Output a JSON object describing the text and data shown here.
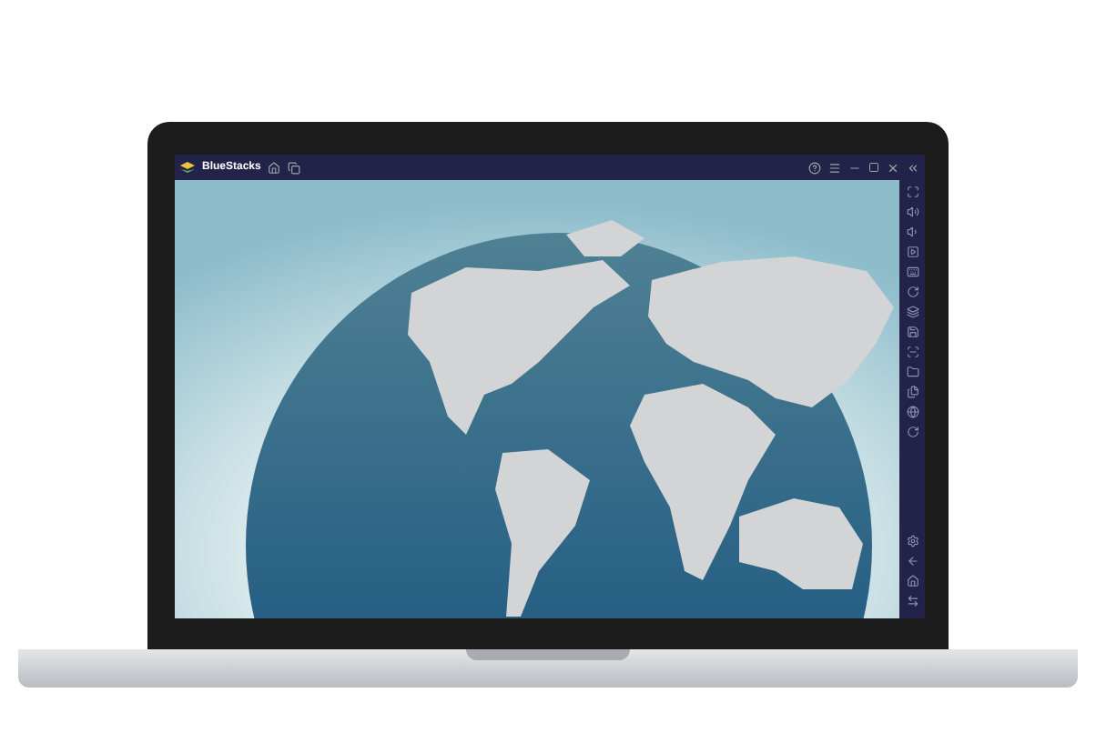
{
  "window": {
    "title": "BlueStacks"
  }
}
